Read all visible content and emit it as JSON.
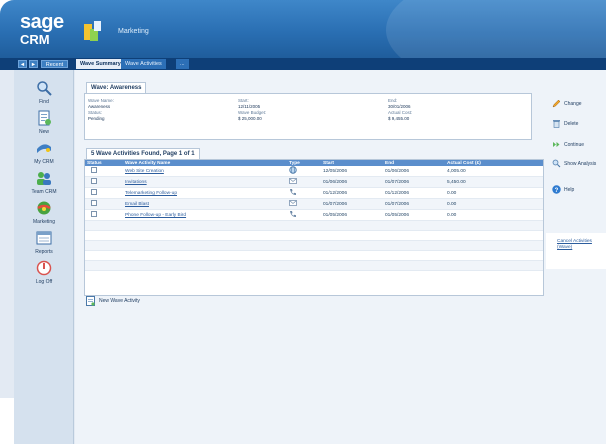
{
  "app": {
    "logo_line1": "sage",
    "logo_line2": "CRM",
    "title": "Marketing"
  },
  "nav": {
    "back": "◄",
    "forward": "►",
    "recent": "Recent",
    "tabs": [
      "Wave Summary",
      "Wave Activities",
      "..."
    ]
  },
  "sidebar": {
    "items": [
      {
        "label": "Find",
        "icon": "magnifier-icon"
      },
      {
        "label": "New",
        "icon": "new-document-icon"
      },
      {
        "label": "My CRM",
        "icon": "my-crm-icon"
      },
      {
        "label": "Team CRM",
        "icon": "team-icon"
      },
      {
        "label": "Marketing",
        "icon": "marketing-icon"
      },
      {
        "label": "Reports",
        "icon": "reports-icon"
      },
      {
        "label": "Log Off",
        "icon": "log-off-icon"
      }
    ]
  },
  "summary": {
    "tab": "Wave: Awareness",
    "fields": [
      {
        "key": "Wave Name:",
        "value": "Awareness"
      },
      {
        "key": "Status:",
        "value": "Pending"
      },
      {
        "key": "Start:",
        "value": "12/11/2005"
      },
      {
        "key": "Wave Budget:",
        "value": "$ 25,000.00"
      },
      {
        "key": "End:",
        "value": "30/01/2006"
      },
      {
        "key": "Actual Cost:",
        "value": "$ 9,455.00"
      }
    ]
  },
  "grid": {
    "tab": "5 Wave Activities Found, Page 1 of 1",
    "columns": [
      "Status",
      "Wave Activity Name",
      "Type",
      "Start",
      "End",
      "Actual Cost (£)"
    ],
    "rows": [
      {
        "name": "Web Site Creation",
        "type_icon": "globe-icon",
        "start": "12/05/2006",
        "end": "01/06/2006",
        "cost": "4,005.00"
      },
      {
        "name": "Invitations",
        "type_icon": "letter-icon",
        "start": "01/06/2006",
        "end": "01/07/2006",
        "cost": "5,450.00"
      },
      {
        "name": "Telemarketing Follow-up",
        "type_icon": "phone-icon",
        "start": "01/12/2006",
        "end": "01/12/2006",
        "cost": "0.00"
      },
      {
        "name": "Email Blast",
        "type_icon": "letter-icon",
        "start": "01/07/2006",
        "end": "01/07/2006",
        "cost": "0.00"
      },
      {
        "name": "Phone Follow-up - Early Bird",
        "type_icon": "phone-icon",
        "start": "01/05/2006",
        "end": "01/05/2006",
        "cost": "0.00"
      }
    ],
    "empty_rows": 5
  },
  "actions": {
    "change": "Change",
    "delete": "Delete",
    "continue": "Continue",
    "show_analysis": "Show Analysis",
    "help": "Help",
    "cancel": "Cancel Activities (Wave)",
    "new_wave_activity": "New Wave Activity"
  },
  "colors": {
    "header_blue": "#2a6fb3",
    "tabbar_navy": "#0e3f78",
    "grid_header": "#5b8ecc"
  }
}
